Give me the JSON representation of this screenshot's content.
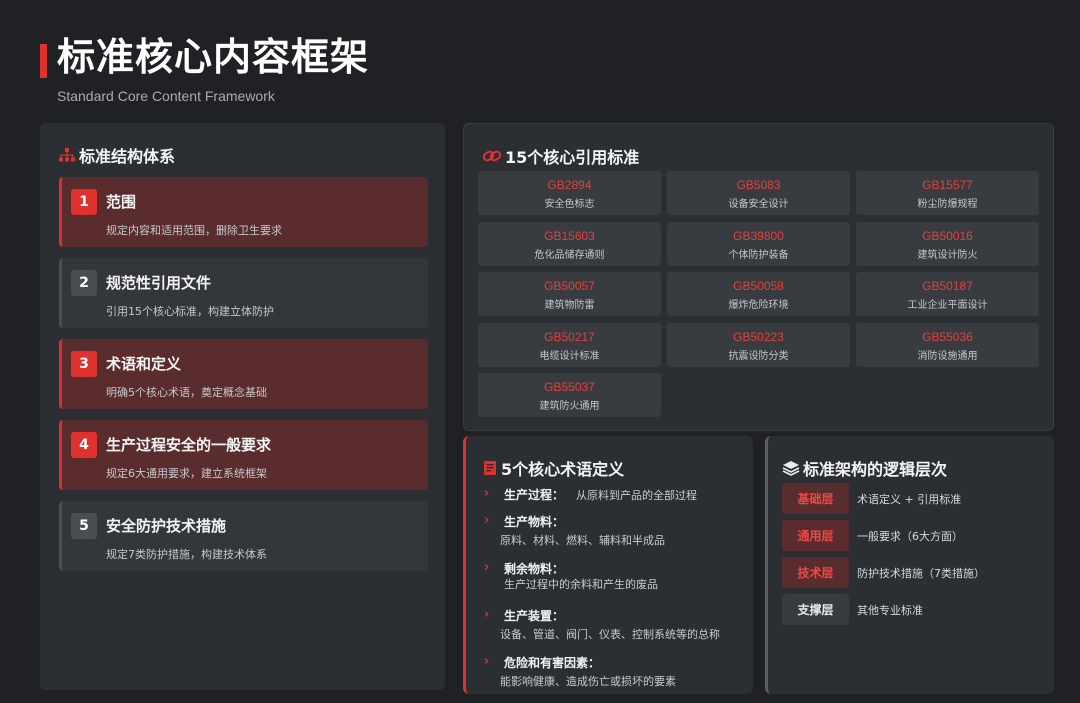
{
  "header": {
    "title": "标准核心内容框架",
    "subtitle": "Standard Core Content Framework"
  },
  "structure": {
    "title": "标准结构体系",
    "icon": "sitemap-icon",
    "items": [
      {
        "num": "1",
        "title": "范围",
        "desc": "规定内容和适用范围，删除卫生要求",
        "accent": true
      },
      {
        "num": "2",
        "title": "规范性引用文件",
        "desc": "引用15个核心标准，构建立体防护",
        "accent": false
      },
      {
        "num": "3",
        "title": "术语和定义",
        "desc": "明确5个核心术语，奠定概念基础",
        "accent": true
      },
      {
        "num": "4",
        "title": "生产过程安全的一般要求",
        "desc": "规定6大通用要求，建立系统框架",
        "accent": true
      },
      {
        "num": "5",
        "title": "安全防护技术措施",
        "desc": "规定7类防护措施，构建技术体系",
        "accent": false
      }
    ]
  },
  "standards": {
    "title": "15个核心引用标准",
    "icon": "link-icon",
    "items": [
      {
        "code": "GB2894",
        "name": "安全色标志"
      },
      {
        "code": "GB5083",
        "name": "设备安全设计"
      },
      {
        "code": "GB15577",
        "name": "粉尘防爆规程"
      },
      {
        "code": "GB15603",
        "name": "危化品储存通则"
      },
      {
        "code": "GB39800",
        "name": "个体防护装备"
      },
      {
        "code": "GB50016",
        "name": "建筑设计防火"
      },
      {
        "code": "GB50057",
        "name": "建筑物防雷"
      },
      {
        "code": "GB50058",
        "name": "爆炸危险环境"
      },
      {
        "code": "GB50187",
        "name": "工业企业平面设计"
      },
      {
        "code": "GB50217",
        "name": "电缆设计标准"
      },
      {
        "code": "GB50223",
        "name": "抗震设防分类"
      },
      {
        "code": "GB55036",
        "name": "消防设施通用"
      },
      {
        "code": "GB55037",
        "name": "建筑防火通用"
      }
    ]
  },
  "terms": {
    "title": "5个核心术语定义",
    "icon": "book-icon",
    "items": [
      {
        "title": "生产过程：",
        "desc": "从原料到产品的全部过程",
        "inline": true
      },
      {
        "title": "生产物料：",
        "desc": "原料、材料、燃料、辅料和半成品",
        "inline": false
      },
      {
        "title": "剩余物料：",
        "desc": "生产过程中的余料和产生的废品",
        "inline": false
      },
      {
        "title": "生产装置：",
        "desc": "设备、管道、阀门、仪表、控制系统等的总称",
        "inline": false
      },
      {
        "title": "危险和有害因素：",
        "desc": "能影响健康、造成伤亡或损坏的要素",
        "inline": false
      }
    ]
  },
  "layers": {
    "title": "标准架构的逻辑层次",
    "icon": "layers-icon",
    "items": [
      {
        "label": "基础层",
        "desc": "术语定义 + 引用标准",
        "style": "red"
      },
      {
        "label": "通用层",
        "desc": "一般要求（6大方面）",
        "style": "red"
      },
      {
        "label": "技术层",
        "desc": "防护技术措施（7类措施）",
        "style": "red"
      },
      {
        "label": "支撑层",
        "desc": "其他专业标准",
        "style": "gray"
      }
    ]
  },
  "colors": {
    "accent": "#e0312f",
    "background": "#1f2125",
    "panel": "#2b2e33"
  }
}
